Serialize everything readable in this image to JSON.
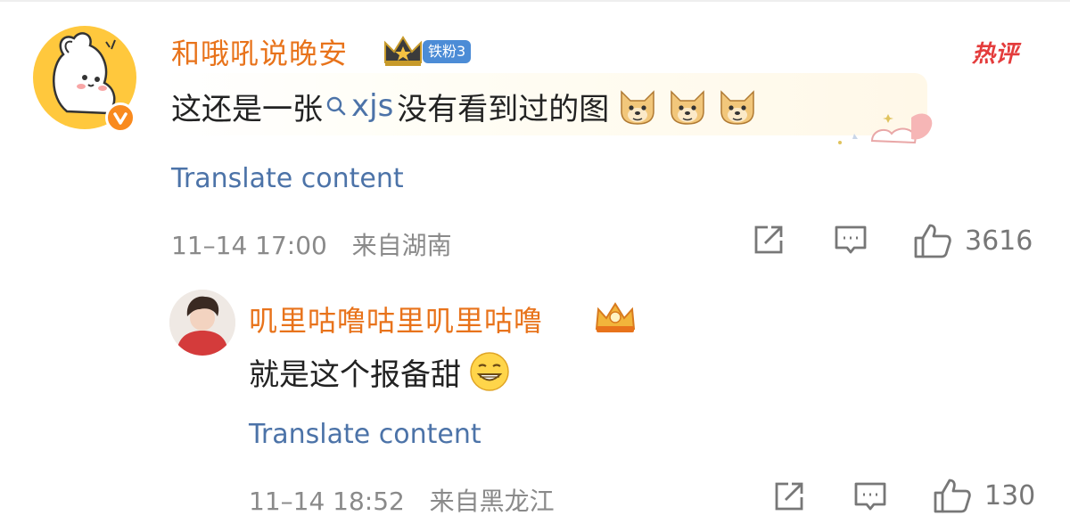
{
  "comments": [
    {
      "username": "和哦吼说晚安",
      "fan_badge": "铁粉3",
      "hot_label": "热评",
      "text_before": "这还是一张",
      "link_text": "xjs",
      "text_after": "没有看到过的图",
      "translate": "Translate content",
      "time": "11–14 17:00",
      "location": "来自湖南",
      "like_count": "3616",
      "emojis": [
        "doge-icon",
        "doge-icon",
        "doge-icon"
      ]
    },
    {
      "username": "叽里咕噜咕里叽里咕噜",
      "text": "就是这个报备甜",
      "translate": "Translate content",
      "time": "11–14 18:52",
      "location": "来自黑龙江",
      "like_count": "130",
      "emojis": [
        "grin-icon"
      ]
    }
  ],
  "colors": {
    "username": "#e8731b",
    "link": "#4c73a8",
    "meta": "#8a8a8a",
    "hot": "#e43c3c",
    "badge": "#4c8cd6"
  }
}
